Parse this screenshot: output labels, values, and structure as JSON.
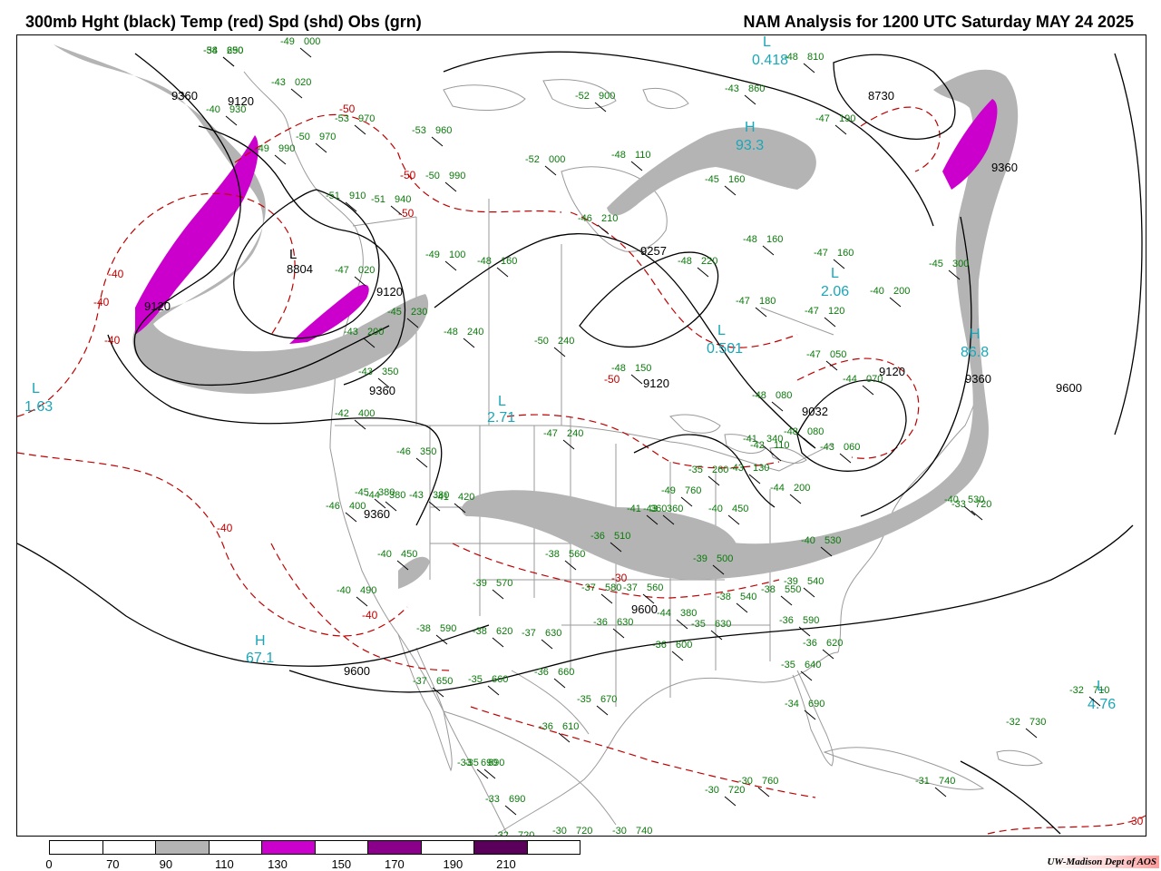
{
  "header": {
    "title_left": "300mb Hght (black) Temp (red) Spd (shd) Obs (grn)",
    "title_right": "NAM Analysis for 1200 UTC Saturday  MAY 24 2025"
  },
  "colors": {
    "height_contour": "#000000",
    "temp_contour": "#c00000",
    "obs_text": "#0a7a0a",
    "center_label": "#1aa7b8",
    "geography": "#9a9a9a",
    "speed_70_90": "#b4b4b4",
    "speed_110_130": "#cc00cc",
    "speed_150_170": "#8a008a",
    "speed_190_210": "#5a005a"
  },
  "colorbar": {
    "labels": [
      "0",
      "70",
      "90",
      "110",
      "130",
      "150",
      "170",
      "190",
      "210"
    ],
    "segments": [
      "#ffffff",
      "#ffffff",
      "#b4b4b4",
      "#ffffff",
      "#cc00cc",
      "#ffffff",
      "#8a008a",
      "#ffffff",
      "#5a005a",
      "#ffffff"
    ]
  },
  "credit": "UW-Madison  Dept of AOS",
  "height_labels": [
    "9360",
    "9120",
    "8804",
    "9120",
    "9360",
    "9120",
    "9257",
    "9120",
    "9360",
    "9600",
    "8730",
    "9360",
    "9032",
    "9360",
    "9600",
    "9600",
    "9120"
  ],
  "temp_labels": [
    "-40",
    "-40",
    "-40",
    "-40",
    "-40",
    "-50",
    "-50",
    "-50",
    "-50",
    "-30",
    "-30"
  ],
  "centers": [
    {
      "letter": "L",
      "value": "1.63"
    },
    {
      "letter": "H",
      "value": "67.1"
    },
    {
      "letter": "L",
      "value": "2.71"
    },
    {
      "letter": "L",
      "value": "0.501"
    },
    {
      "letter": "L",
      "value": "2.06"
    },
    {
      "letter": "H",
      "value": "86.8"
    },
    {
      "letter": "L",
      "value": "0.418"
    },
    {
      "letter": "H",
      "value": "93.3"
    },
    {
      "letter": "L",
      "value": "4.76"
    },
    {
      "letter": "L",
      "value": "1.63"
    }
  ],
  "observations": [
    {
      "t": "-38",
      "h": "250"
    },
    {
      "t": "-49",
      "h": "000"
    },
    {
      "t": "-43",
      "h": "020"
    },
    {
      "t": "-40",
      "h": "930"
    },
    {
      "t": "-53",
      "h": "970"
    },
    {
      "t": "-50",
      "h": "970"
    },
    {
      "t": "-49",
      "h": "990"
    },
    {
      "t": "-53",
      "h": "960"
    },
    {
      "t": "-50",
      "h": "990"
    },
    {
      "t": "-52",
      "h": "000"
    },
    {
      "t": "-52",
      "h": "900"
    },
    {
      "t": "-43",
      "h": "860"
    },
    {
      "t": "-48",
      "h": "110"
    },
    {
      "t": "-45",
      "h": "160"
    },
    {
      "t": "-46",
      "h": "210"
    },
    {
      "t": "-51",
      "h": "910"
    },
    {
      "t": "-51",
      "h": "940"
    },
    {
      "t": "-49",
      "h": "100"
    },
    {
      "t": "-48",
      "h": "160"
    },
    {
      "t": "-48",
      "h": "220"
    },
    {
      "t": "-48",
      "h": "160"
    },
    {
      "t": "-47",
      "h": "160"
    },
    {
      "t": "-45",
      "h": "300"
    },
    {
      "t": "-47",
      "h": "020"
    },
    {
      "t": "-45",
      "h": "230"
    },
    {
      "t": "-48",
      "h": "240"
    },
    {
      "t": "-50",
      "h": "240"
    },
    {
      "t": "-47",
      "h": "180"
    },
    {
      "t": "-47",
      "h": "120"
    },
    {
      "t": "-40",
      "h": "200"
    },
    {
      "t": "-43",
      "h": "200"
    },
    {
      "t": "-43",
      "h": "350"
    },
    {
      "t": "-42",
      "h": "400"
    },
    {
      "t": "-48",
      "h": "150"
    },
    {
      "t": "-47",
      "h": "050"
    },
    {
      "t": "-44",
      "h": "070"
    },
    {
      "t": "-48",
      "h": "080"
    },
    {
      "t": "-48",
      "h": "080"
    },
    {
      "t": "-43",
      "h": "060"
    },
    {
      "t": "-42",
      "h": "110"
    },
    {
      "t": "-47",
      "h": "240"
    },
    {
      "t": "-46",
      "h": "350"
    },
    {
      "t": "-44",
      "h": "380"
    },
    {
      "t": "-43",
      "h": "380"
    },
    {
      "t": "-45",
      "h": "380"
    },
    {
      "t": "-41",
      "h": "420"
    },
    {
      "t": "-46",
      "h": "400"
    },
    {
      "t": "-43",
      "h": "360"
    },
    {
      "t": "-40",
      "h": "450"
    },
    {
      "t": "-40",
      "h": "530"
    },
    {
      "t": "-40",
      "h": "490"
    },
    {
      "t": "-38",
      "h": "590"
    },
    {
      "t": "-39",
      "h": "570"
    },
    {
      "t": "-38",
      "h": "560"
    },
    {
      "t": "-36",
      "h": "510"
    },
    {
      "t": "-37",
      "h": "580"
    },
    {
      "t": "-36",
      "h": "630"
    },
    {
      "t": "-38",
      "h": "620"
    },
    {
      "t": "-37",
      "h": "630"
    },
    {
      "t": "-37",
      "h": "560"
    },
    {
      "t": "-39",
      "h": "500"
    },
    {
      "t": "-38",
      "h": "540"
    },
    {
      "t": "-38",
      "h": "550"
    },
    {
      "t": "-39",
      "h": "540"
    },
    {
      "t": "-36",
      "h": "590"
    },
    {
      "t": "-36",
      "h": "620"
    },
    {
      "t": "-35",
      "h": "640"
    },
    {
      "t": "-34",
      "h": "690"
    },
    {
      "t": "-37",
      "h": "650"
    },
    {
      "t": "-35",
      "h": "660"
    },
    {
      "t": "-36",
      "h": "660"
    },
    {
      "t": "-35",
      "h": "670"
    },
    {
      "t": "-33",
      "h": "690"
    },
    {
      "t": "-35",
      "h": "690"
    },
    {
      "t": "-33",
      "h": "690"
    },
    {
      "t": "-32",
      "h": "720"
    },
    {
      "t": "-30",
      "h": "720"
    },
    {
      "t": "-30",
      "h": "740"
    },
    {
      "t": "-30",
      "h": "720"
    },
    {
      "t": "-30",
      "h": "760"
    },
    {
      "t": "-31",
      "h": "740"
    },
    {
      "t": "-32",
      "h": "730"
    },
    {
      "t": "-32",
      "h": "710"
    },
    {
      "t": "-33",
      "h": "720"
    },
    {
      "t": "-40",
      "h": "530"
    },
    {
      "t": "-40",
      "h": "450"
    },
    {
      "t": "-41",
      "h": "340"
    },
    {
      "t": "-43",
      "h": "130"
    },
    {
      "t": "-44",
      "h": "200"
    },
    {
      "t": "-35",
      "h": "260"
    },
    {
      "t": "-47",
      "h": "190"
    },
    {
      "t": "-48",
      "h": "810"
    },
    {
      "t": "-49",
      "h": "760"
    },
    {
      "t": "-41",
      "h": "360"
    },
    {
      "t": "-44",
      "h": "380"
    },
    {
      "t": "-36",
      "h": "600"
    },
    {
      "t": "-35",
      "h": "630"
    },
    {
      "t": "-36",
      "h": "610"
    },
    {
      "t": "-54",
      "h": "690"
    }
  ]
}
